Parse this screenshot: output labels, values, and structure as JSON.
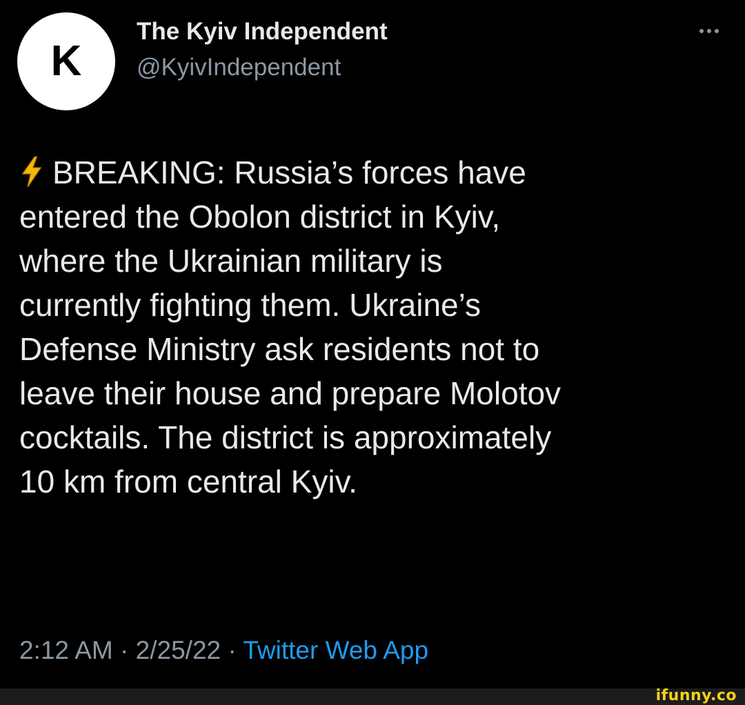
{
  "account": {
    "avatar_letter": "K",
    "display_name": "The Kyiv Independent",
    "handle": "@KyivIndependent"
  },
  "more_icon": "more-horizontal-icon",
  "tweet": {
    "emoji_icon": "lightning-bolt-icon",
    "text": "BREAKING: Russia’s forces have\nentered the Obolon district in Kyiv,\nwhere the Ukrainian military is\ncurrently fighting them. Ukraine’s\nDefense Ministry ask residents not to\nleave their house and prepare Molotov\ncocktails. The district is approximately\n10 km from central Kyiv.",
    "time": "2:12 AM",
    "separator": "·",
    "date": "2/25/22",
    "source": "Twitter Web App"
  },
  "watermark": {
    "text": "ifunny.co"
  },
  "colors": {
    "background": "#000000",
    "primary_text": "#e7e9ea",
    "secondary_text": "#8b98a5",
    "link": "#1d9bf0",
    "bolt": "#f5b800",
    "watermark": "#f2d11a"
  }
}
